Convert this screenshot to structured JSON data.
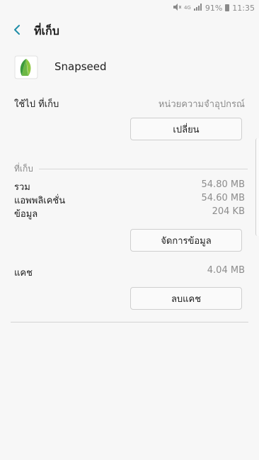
{
  "status_bar": {
    "network": "4G",
    "battery": "91%",
    "time": "11:35"
  },
  "header": {
    "title": "ที่เก็บ",
    "back_icon": "chevron-left-icon"
  },
  "app": {
    "name": "Snapseed",
    "icon": "snapseed-leaf-icon"
  },
  "storage_used": {
    "label": "ใช้ไป ที่เก็บ",
    "value": "หน่วยความจำอุปกรณ์",
    "change_button": "เปลี่ยน"
  },
  "storage_section": {
    "header": "ที่เก็บ",
    "rows": [
      {
        "label": "รวม",
        "value": "54.80 MB"
      },
      {
        "label": "แอพพลิเคชั่น",
        "value": "54.60 MB"
      },
      {
        "label": "ข้อมูล",
        "value": "204 KB"
      }
    ],
    "manage_button": "จัดการข้อมูล"
  },
  "cache": {
    "label": "แคช",
    "value": "4.04 MB",
    "clear_button": "ลบแคช"
  },
  "colors": {
    "background": "#f7f7f7",
    "accent": "#1f8ea8",
    "secondary_text": "#8c8c8c"
  }
}
